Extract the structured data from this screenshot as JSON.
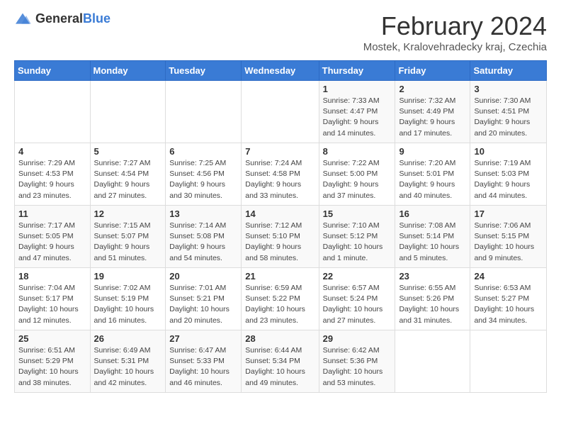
{
  "header": {
    "logo": {
      "general": "General",
      "blue": "Blue"
    },
    "title": "February 2024",
    "location": "Mostek, Kralovehradecky kraj, Czechia"
  },
  "weekdays": [
    "Sunday",
    "Monday",
    "Tuesday",
    "Wednesday",
    "Thursday",
    "Friday",
    "Saturday"
  ],
  "weeks": [
    [
      {
        "day": "",
        "detail": ""
      },
      {
        "day": "",
        "detail": ""
      },
      {
        "day": "",
        "detail": ""
      },
      {
        "day": "",
        "detail": ""
      },
      {
        "day": "1",
        "detail": "Sunrise: 7:33 AM\nSunset: 4:47 PM\nDaylight: 9 hours\nand 14 minutes."
      },
      {
        "day": "2",
        "detail": "Sunrise: 7:32 AM\nSunset: 4:49 PM\nDaylight: 9 hours\nand 17 minutes."
      },
      {
        "day": "3",
        "detail": "Sunrise: 7:30 AM\nSunset: 4:51 PM\nDaylight: 9 hours\nand 20 minutes."
      }
    ],
    [
      {
        "day": "4",
        "detail": "Sunrise: 7:29 AM\nSunset: 4:53 PM\nDaylight: 9 hours\nand 23 minutes."
      },
      {
        "day": "5",
        "detail": "Sunrise: 7:27 AM\nSunset: 4:54 PM\nDaylight: 9 hours\nand 27 minutes."
      },
      {
        "day": "6",
        "detail": "Sunrise: 7:25 AM\nSunset: 4:56 PM\nDaylight: 9 hours\nand 30 minutes."
      },
      {
        "day": "7",
        "detail": "Sunrise: 7:24 AM\nSunset: 4:58 PM\nDaylight: 9 hours\nand 33 minutes."
      },
      {
        "day": "8",
        "detail": "Sunrise: 7:22 AM\nSunset: 5:00 PM\nDaylight: 9 hours\nand 37 minutes."
      },
      {
        "day": "9",
        "detail": "Sunrise: 7:20 AM\nSunset: 5:01 PM\nDaylight: 9 hours\nand 40 minutes."
      },
      {
        "day": "10",
        "detail": "Sunrise: 7:19 AM\nSunset: 5:03 PM\nDaylight: 9 hours\nand 44 minutes."
      }
    ],
    [
      {
        "day": "11",
        "detail": "Sunrise: 7:17 AM\nSunset: 5:05 PM\nDaylight: 9 hours\nand 47 minutes."
      },
      {
        "day": "12",
        "detail": "Sunrise: 7:15 AM\nSunset: 5:07 PM\nDaylight: 9 hours\nand 51 minutes."
      },
      {
        "day": "13",
        "detail": "Sunrise: 7:14 AM\nSunset: 5:08 PM\nDaylight: 9 hours\nand 54 minutes."
      },
      {
        "day": "14",
        "detail": "Sunrise: 7:12 AM\nSunset: 5:10 PM\nDaylight: 9 hours\nand 58 minutes."
      },
      {
        "day": "15",
        "detail": "Sunrise: 7:10 AM\nSunset: 5:12 PM\nDaylight: 10 hours\nand 1 minute."
      },
      {
        "day": "16",
        "detail": "Sunrise: 7:08 AM\nSunset: 5:14 PM\nDaylight: 10 hours\nand 5 minutes."
      },
      {
        "day": "17",
        "detail": "Sunrise: 7:06 AM\nSunset: 5:15 PM\nDaylight: 10 hours\nand 9 minutes."
      }
    ],
    [
      {
        "day": "18",
        "detail": "Sunrise: 7:04 AM\nSunset: 5:17 PM\nDaylight: 10 hours\nand 12 minutes."
      },
      {
        "day": "19",
        "detail": "Sunrise: 7:02 AM\nSunset: 5:19 PM\nDaylight: 10 hours\nand 16 minutes."
      },
      {
        "day": "20",
        "detail": "Sunrise: 7:01 AM\nSunset: 5:21 PM\nDaylight: 10 hours\nand 20 minutes."
      },
      {
        "day": "21",
        "detail": "Sunrise: 6:59 AM\nSunset: 5:22 PM\nDaylight: 10 hours\nand 23 minutes."
      },
      {
        "day": "22",
        "detail": "Sunrise: 6:57 AM\nSunset: 5:24 PM\nDaylight: 10 hours\nand 27 minutes."
      },
      {
        "day": "23",
        "detail": "Sunrise: 6:55 AM\nSunset: 5:26 PM\nDaylight: 10 hours\nand 31 minutes."
      },
      {
        "day": "24",
        "detail": "Sunrise: 6:53 AM\nSunset: 5:27 PM\nDaylight: 10 hours\nand 34 minutes."
      }
    ],
    [
      {
        "day": "25",
        "detail": "Sunrise: 6:51 AM\nSunset: 5:29 PM\nDaylight: 10 hours\nand 38 minutes."
      },
      {
        "day": "26",
        "detail": "Sunrise: 6:49 AM\nSunset: 5:31 PM\nDaylight: 10 hours\nand 42 minutes."
      },
      {
        "day": "27",
        "detail": "Sunrise: 6:47 AM\nSunset: 5:33 PM\nDaylight: 10 hours\nand 46 minutes."
      },
      {
        "day": "28",
        "detail": "Sunrise: 6:44 AM\nSunset: 5:34 PM\nDaylight: 10 hours\nand 49 minutes."
      },
      {
        "day": "29",
        "detail": "Sunrise: 6:42 AM\nSunset: 5:36 PM\nDaylight: 10 hours\nand 53 minutes."
      },
      {
        "day": "",
        "detail": ""
      },
      {
        "day": "",
        "detail": ""
      }
    ]
  ]
}
